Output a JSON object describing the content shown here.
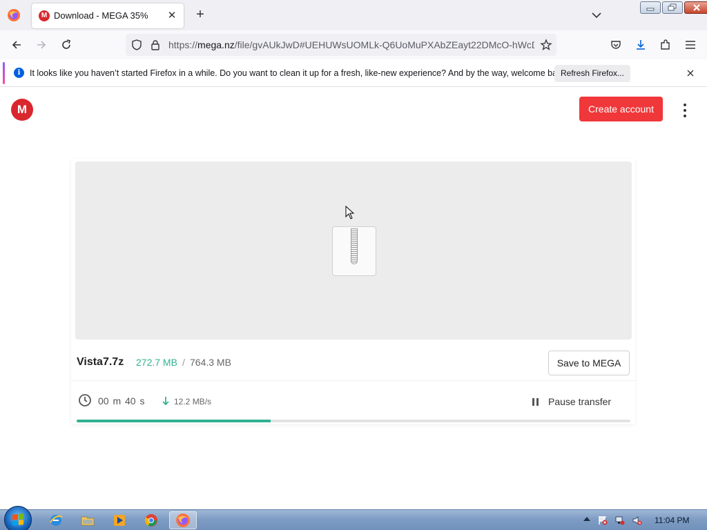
{
  "browser": {
    "tab": {
      "title": "Download - MEGA 35%",
      "favicon": "M"
    },
    "url": {
      "scheme": "https://",
      "host": "mega.nz",
      "path": "/file/gvAUkJwD#UEHUWsUOMLk-Q6UoMuPXAbZEayt22DMcO-hWcD"
    },
    "notification": {
      "text": "It looks like you haven’t started Firefox in a while. Do you want to clean it up for a fresh, like-new experience? And by the way, welcome back!",
      "button": "Refresh Firefox...",
      "icon": "info-icon"
    }
  },
  "page": {
    "logo": "M",
    "create_account": "Create account",
    "file": {
      "name": "Vista7.7z",
      "downloaded": "272.7 MB",
      "separator": "/",
      "total": "764.3 MB",
      "icon": "zip-file-icon"
    },
    "save_to_mega": "Save to MEGA",
    "time_remaining": "00 m 40 s",
    "speed": "12.2 MB/s",
    "pause": "Pause transfer",
    "progress": 0.35
  },
  "taskbar": {
    "apps": [
      "internet-explorer-icon",
      "file-explorer-icon",
      "media-player-icon",
      "chrome-icon",
      "firefox-icon"
    ],
    "clock": "11:04 PM"
  },
  "colors": {
    "mega_red": "#d9272e",
    "button_red": "#f0373a",
    "progress_green": "#31b191"
  }
}
